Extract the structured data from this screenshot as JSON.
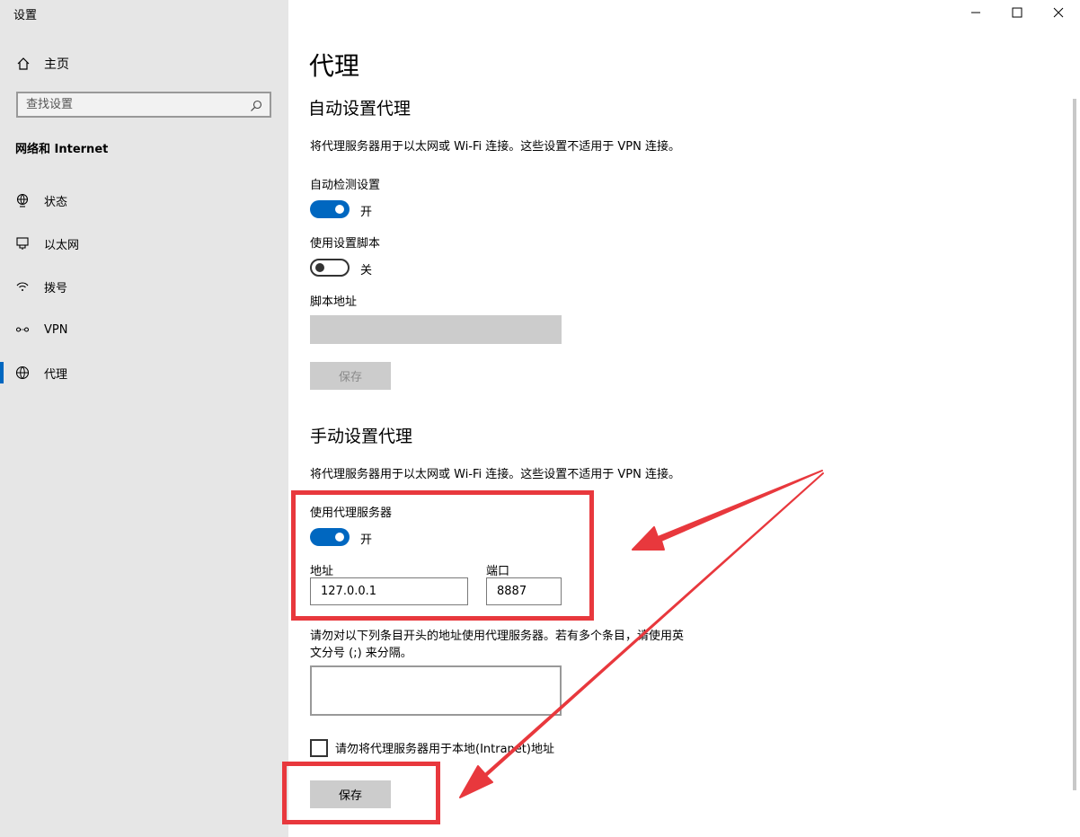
{
  "window": {
    "title": "设置"
  },
  "sidebar": {
    "home_label": "主页",
    "search_placeholder": "查找设置",
    "section_label": "网络和 Internet",
    "items": [
      {
        "label": "状态",
        "icon": "status-globe-icon"
      },
      {
        "label": "以太网",
        "icon": "ethernet-icon"
      },
      {
        "label": "拨号",
        "icon": "dialup-icon"
      },
      {
        "label": "VPN",
        "icon": "vpn-icon"
      },
      {
        "label": "代理",
        "icon": "globe-icon",
        "active": true
      }
    ]
  },
  "main": {
    "page_title": "代理",
    "auto": {
      "heading": "自动设置代理",
      "description": "将代理服务器用于以太网或 Wi-Fi 连接。这些设置不适用于 VPN 连接。",
      "detect_label": "自动检测设置",
      "detect_state": "开",
      "detect_on": true,
      "script_label": "使用设置脚本",
      "script_state": "关",
      "script_on": false,
      "address_label": "脚本地址",
      "address_value": "",
      "save_label": "保存"
    },
    "manual": {
      "heading": "手动设置代理",
      "description": "将代理服务器用于以太网或 Wi-Fi 连接。这些设置不适用于 VPN 连接。",
      "proxy_label": "使用代理服务器",
      "proxy_state": "开",
      "proxy_on": true,
      "address_label": "地址",
      "address_value": "127.0.0.1",
      "port_label": "端口",
      "port_value": "8887",
      "exceptions_line1": "请勿对以下列条目开头的地址使用代理服务器。若有多个条目，请使用英",
      "exceptions_line2": "文分号 (;) 来分隔。",
      "exceptions_value": "",
      "local_checkbox_label": "请勿将代理服务器用于本地(Intranet)地址",
      "local_checked": false,
      "save_label": "保存"
    }
  },
  "colors": {
    "accent": "#0067c0",
    "annotation_red": "#e8383d",
    "sidebar_bg": "#e6e6e6",
    "button_bg": "#cccccc"
  }
}
